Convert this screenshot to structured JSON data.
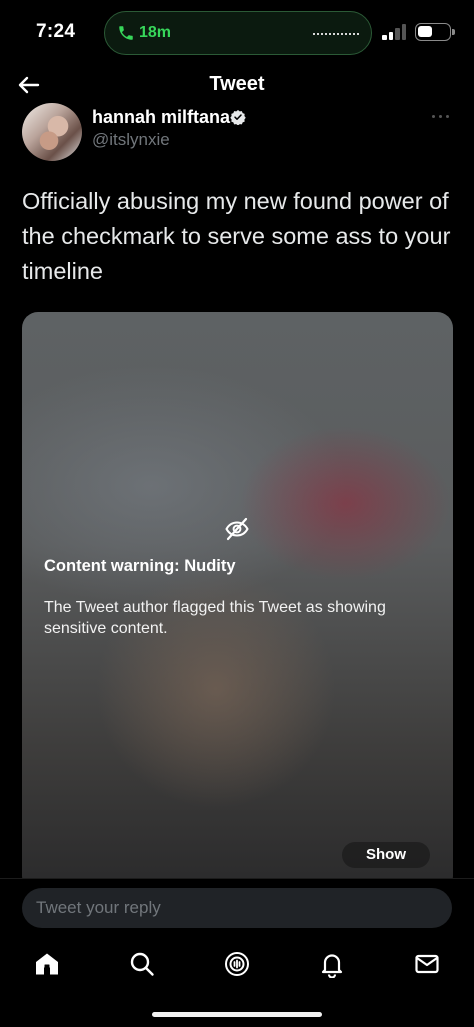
{
  "status_bar": {
    "time": "7:24",
    "call_duration": "18m",
    "call_color": "#37d65a",
    "signal_bars": 2,
    "signal_bars_total": 4,
    "battery_level": 0.45
  },
  "header": {
    "title": "Tweet",
    "back_icon": "arrow-left-icon"
  },
  "tweet": {
    "author": {
      "name": "hannah milftana",
      "handle": "@itslynxie",
      "verified": true,
      "verified_icon": "verified-badge-icon"
    },
    "more_icon": "more-horizontal-icon",
    "text": "Officially abusing my new found power of the checkmark to serve some ass to your timeline",
    "media": {
      "hidden_icon": "eye-slash-icon",
      "warning_title": "Content warning: Nudity",
      "warning_description": "The Tweet author flagged this Tweet as showing sensitive content.",
      "show_label": "Show"
    }
  },
  "reply": {
    "placeholder": "Tweet your reply"
  },
  "tab_bar": {
    "tabs": [
      {
        "id": "home",
        "icon": "home-icon",
        "active": true
      },
      {
        "id": "search",
        "icon": "search-icon",
        "active": false
      },
      {
        "id": "spaces",
        "icon": "spaces-icon",
        "active": false
      },
      {
        "id": "notifications",
        "icon": "bell-icon",
        "active": false
      },
      {
        "id": "messages",
        "icon": "mail-icon",
        "active": false
      }
    ]
  }
}
